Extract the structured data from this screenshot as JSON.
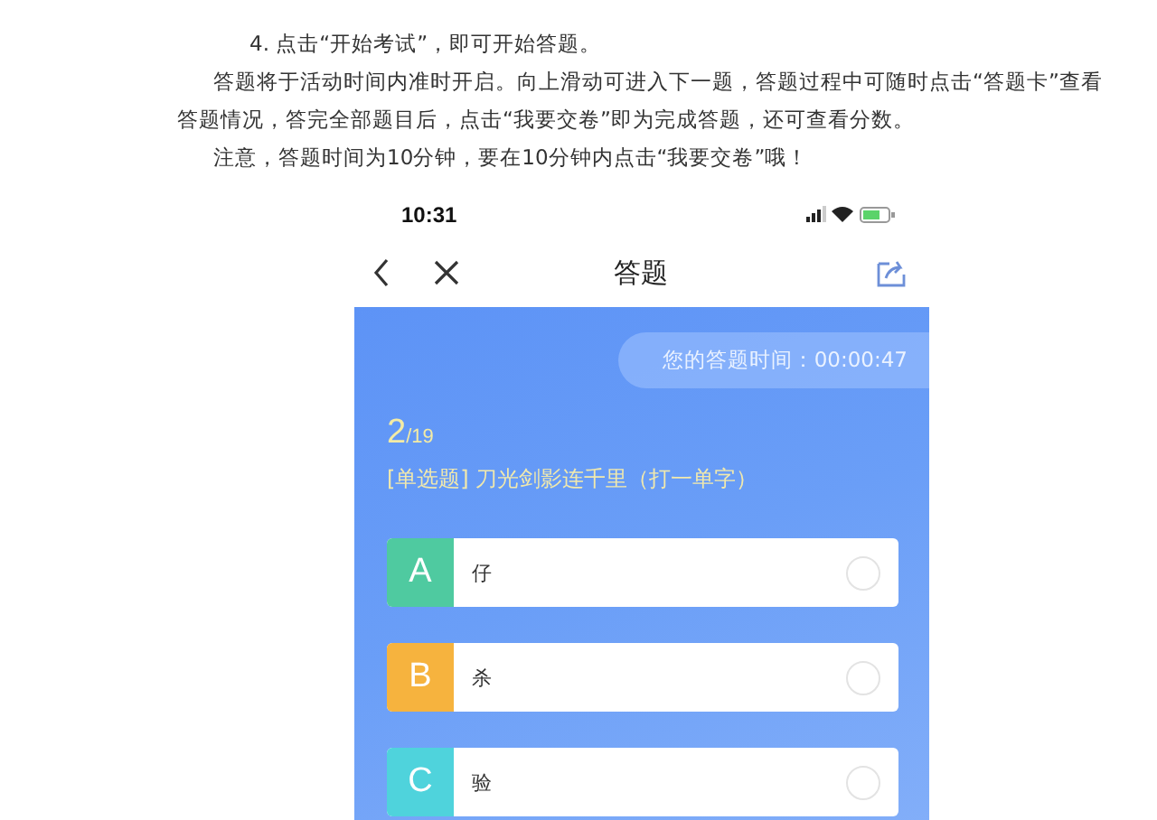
{
  "article": {
    "paragraphs": [
      {
        "kind": "step",
        "text": "4. 点击“开始考试”，即可开始答题。"
      },
      {
        "kind": "body",
        "text": "答题将于活动时间内准时开启。向上滑动可进入下一题，答题过程中可随时点击“答题卡”查看答题情况，答完全部题目后，点击“我要交卷”即为完成答题，还可查看分数。"
      },
      {
        "kind": "body",
        "text": "注意，答题时间为10分钟，要在10分钟内点击“我要交卷”哦！"
      }
    ]
  },
  "phone": {
    "status_time": "10:31",
    "nav_title": "答题",
    "timer": "您的答题时间：00:00:47",
    "progress_current": "2",
    "progress_total": "/19",
    "question": "[单选题] 刀光剑影连千里（打一单字）",
    "options": [
      {
        "letter": "A",
        "text": "仔",
        "color": "#4fcaa0",
        "selected": false
      },
      {
        "letter": "B",
        "text": "杀",
        "color": "#f6b33e",
        "selected": false
      },
      {
        "letter": "C",
        "text": "验",
        "color": "#4fd3dc",
        "selected": false
      }
    ]
  }
}
